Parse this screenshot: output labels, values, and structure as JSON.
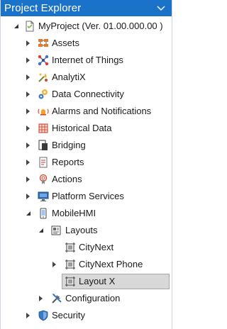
{
  "panel": {
    "title": "Project Explorer",
    "accent": "#1b73c9"
  },
  "tree": {
    "root": {
      "label": "MyProject (Ver. 01.00.000.00 )",
      "icon": "project-icon",
      "expanded": true
    },
    "items": [
      {
        "label": "Assets",
        "icon": "assets-icon"
      },
      {
        "label": "Internet of Things",
        "icon": "iot-icon"
      },
      {
        "label": "AnalytiX",
        "icon": "analytix-icon"
      },
      {
        "label": "Data Connectivity",
        "icon": "data-connectivity-icon"
      },
      {
        "label": "Alarms and Notifications",
        "icon": "alarm-icon"
      },
      {
        "label": "Historical Data",
        "icon": "historical-data-icon"
      },
      {
        "label": "Bridging",
        "icon": "bridging-icon"
      },
      {
        "label": "Reports",
        "icon": "reports-icon"
      },
      {
        "label": "Actions",
        "icon": "actions-icon"
      },
      {
        "label": "Platform Services",
        "icon": "platform-services-icon"
      },
      {
        "label": "MobileHMI",
        "icon": "mobilehmi-icon",
        "expanded": true
      },
      {
        "label": "Layouts",
        "icon": "layouts-icon",
        "expanded": true
      },
      {
        "label": "CityNext",
        "icon": "layout-icon"
      },
      {
        "label": "CityNext Phone",
        "icon": "layout-icon"
      },
      {
        "label": "Layout X",
        "icon": "layout-icon",
        "selected": true
      },
      {
        "label": "Configuration",
        "icon": "configuration-icon"
      },
      {
        "label": "Security",
        "icon": "security-icon"
      }
    ]
  }
}
